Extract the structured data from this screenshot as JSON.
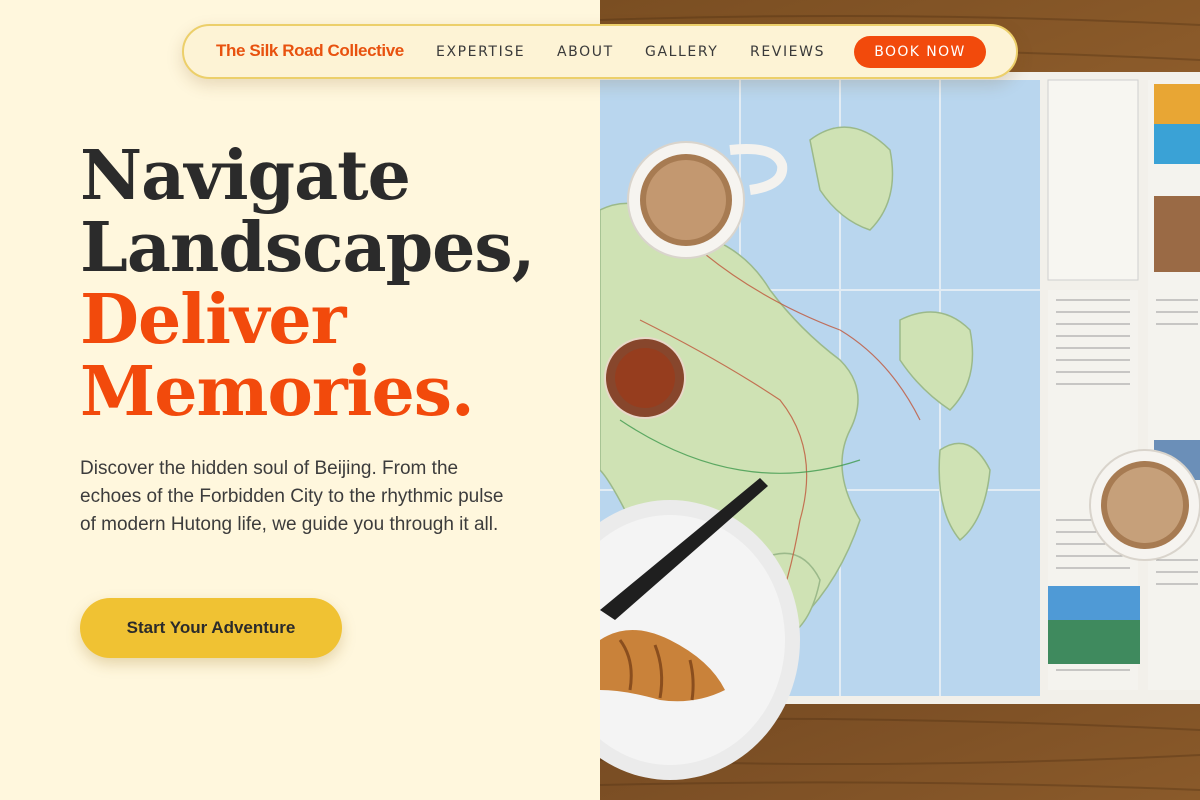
{
  "nav": {
    "brand": "The Silk Road Collective",
    "links": [
      "EXPERTISE",
      "ABOUT",
      "GALLERY",
      "REVIEWS"
    ],
    "cta": "BOOK NOW"
  },
  "hero": {
    "headline_line1": "Navigate",
    "headline_line2": "Landscapes,",
    "headline_accent_line1": "Deliver",
    "headline_accent_line2": "Memories.",
    "description": "Discover the hidden soul of Beijing. From the echoes of the Forbidden City to the rhythmic pulse of modern Hutong life, we guide you through it all.",
    "cta": "Start Your Adventure"
  },
  "colors": {
    "accent": "#f24a0c",
    "cta_yellow": "#f0c233",
    "background": "#fff7dd",
    "text": "#2b2b2b"
  },
  "photo": {
    "subject": "travel-map-with-coffee-and-croissant-photo"
  }
}
